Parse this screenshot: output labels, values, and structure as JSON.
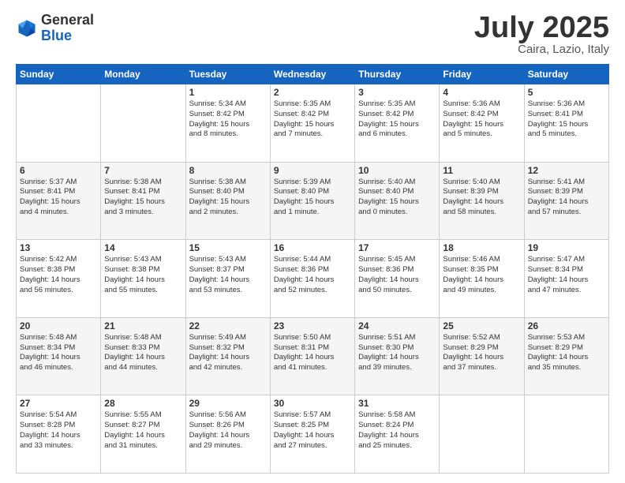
{
  "header": {
    "logo_general": "General",
    "logo_blue": "Blue",
    "title": "July 2025",
    "location": "Caira, Lazio, Italy"
  },
  "weekdays": [
    "Sunday",
    "Monday",
    "Tuesday",
    "Wednesday",
    "Thursday",
    "Friday",
    "Saturday"
  ],
  "weeks": [
    [
      {
        "day": "",
        "info": ""
      },
      {
        "day": "",
        "info": ""
      },
      {
        "day": "1",
        "info": "Sunrise: 5:34 AM\nSunset: 8:42 PM\nDaylight: 15 hours\nand 8 minutes."
      },
      {
        "day": "2",
        "info": "Sunrise: 5:35 AM\nSunset: 8:42 PM\nDaylight: 15 hours\nand 7 minutes."
      },
      {
        "day": "3",
        "info": "Sunrise: 5:35 AM\nSunset: 8:42 PM\nDaylight: 15 hours\nand 6 minutes."
      },
      {
        "day": "4",
        "info": "Sunrise: 5:36 AM\nSunset: 8:42 PM\nDaylight: 15 hours\nand 5 minutes."
      },
      {
        "day": "5",
        "info": "Sunrise: 5:36 AM\nSunset: 8:41 PM\nDaylight: 15 hours\nand 5 minutes."
      }
    ],
    [
      {
        "day": "6",
        "info": "Sunrise: 5:37 AM\nSunset: 8:41 PM\nDaylight: 15 hours\nand 4 minutes."
      },
      {
        "day": "7",
        "info": "Sunrise: 5:38 AM\nSunset: 8:41 PM\nDaylight: 15 hours\nand 3 minutes."
      },
      {
        "day": "8",
        "info": "Sunrise: 5:38 AM\nSunset: 8:40 PM\nDaylight: 15 hours\nand 2 minutes."
      },
      {
        "day": "9",
        "info": "Sunrise: 5:39 AM\nSunset: 8:40 PM\nDaylight: 15 hours\nand 1 minute."
      },
      {
        "day": "10",
        "info": "Sunrise: 5:40 AM\nSunset: 8:40 PM\nDaylight: 15 hours\nand 0 minutes."
      },
      {
        "day": "11",
        "info": "Sunrise: 5:40 AM\nSunset: 8:39 PM\nDaylight: 14 hours\nand 58 minutes."
      },
      {
        "day": "12",
        "info": "Sunrise: 5:41 AM\nSunset: 8:39 PM\nDaylight: 14 hours\nand 57 minutes."
      }
    ],
    [
      {
        "day": "13",
        "info": "Sunrise: 5:42 AM\nSunset: 8:38 PM\nDaylight: 14 hours\nand 56 minutes."
      },
      {
        "day": "14",
        "info": "Sunrise: 5:43 AM\nSunset: 8:38 PM\nDaylight: 14 hours\nand 55 minutes."
      },
      {
        "day": "15",
        "info": "Sunrise: 5:43 AM\nSunset: 8:37 PM\nDaylight: 14 hours\nand 53 minutes."
      },
      {
        "day": "16",
        "info": "Sunrise: 5:44 AM\nSunset: 8:36 PM\nDaylight: 14 hours\nand 52 minutes."
      },
      {
        "day": "17",
        "info": "Sunrise: 5:45 AM\nSunset: 8:36 PM\nDaylight: 14 hours\nand 50 minutes."
      },
      {
        "day": "18",
        "info": "Sunrise: 5:46 AM\nSunset: 8:35 PM\nDaylight: 14 hours\nand 49 minutes."
      },
      {
        "day": "19",
        "info": "Sunrise: 5:47 AM\nSunset: 8:34 PM\nDaylight: 14 hours\nand 47 minutes."
      }
    ],
    [
      {
        "day": "20",
        "info": "Sunrise: 5:48 AM\nSunset: 8:34 PM\nDaylight: 14 hours\nand 46 minutes."
      },
      {
        "day": "21",
        "info": "Sunrise: 5:48 AM\nSunset: 8:33 PM\nDaylight: 14 hours\nand 44 minutes."
      },
      {
        "day": "22",
        "info": "Sunrise: 5:49 AM\nSunset: 8:32 PM\nDaylight: 14 hours\nand 42 minutes."
      },
      {
        "day": "23",
        "info": "Sunrise: 5:50 AM\nSunset: 8:31 PM\nDaylight: 14 hours\nand 41 minutes."
      },
      {
        "day": "24",
        "info": "Sunrise: 5:51 AM\nSunset: 8:30 PM\nDaylight: 14 hours\nand 39 minutes."
      },
      {
        "day": "25",
        "info": "Sunrise: 5:52 AM\nSunset: 8:29 PM\nDaylight: 14 hours\nand 37 minutes."
      },
      {
        "day": "26",
        "info": "Sunrise: 5:53 AM\nSunset: 8:29 PM\nDaylight: 14 hours\nand 35 minutes."
      }
    ],
    [
      {
        "day": "27",
        "info": "Sunrise: 5:54 AM\nSunset: 8:28 PM\nDaylight: 14 hours\nand 33 minutes."
      },
      {
        "day": "28",
        "info": "Sunrise: 5:55 AM\nSunset: 8:27 PM\nDaylight: 14 hours\nand 31 minutes."
      },
      {
        "day": "29",
        "info": "Sunrise: 5:56 AM\nSunset: 8:26 PM\nDaylight: 14 hours\nand 29 minutes."
      },
      {
        "day": "30",
        "info": "Sunrise: 5:57 AM\nSunset: 8:25 PM\nDaylight: 14 hours\nand 27 minutes."
      },
      {
        "day": "31",
        "info": "Sunrise: 5:58 AM\nSunset: 8:24 PM\nDaylight: 14 hours\nand 25 minutes."
      },
      {
        "day": "",
        "info": ""
      },
      {
        "day": "",
        "info": ""
      }
    ]
  ]
}
